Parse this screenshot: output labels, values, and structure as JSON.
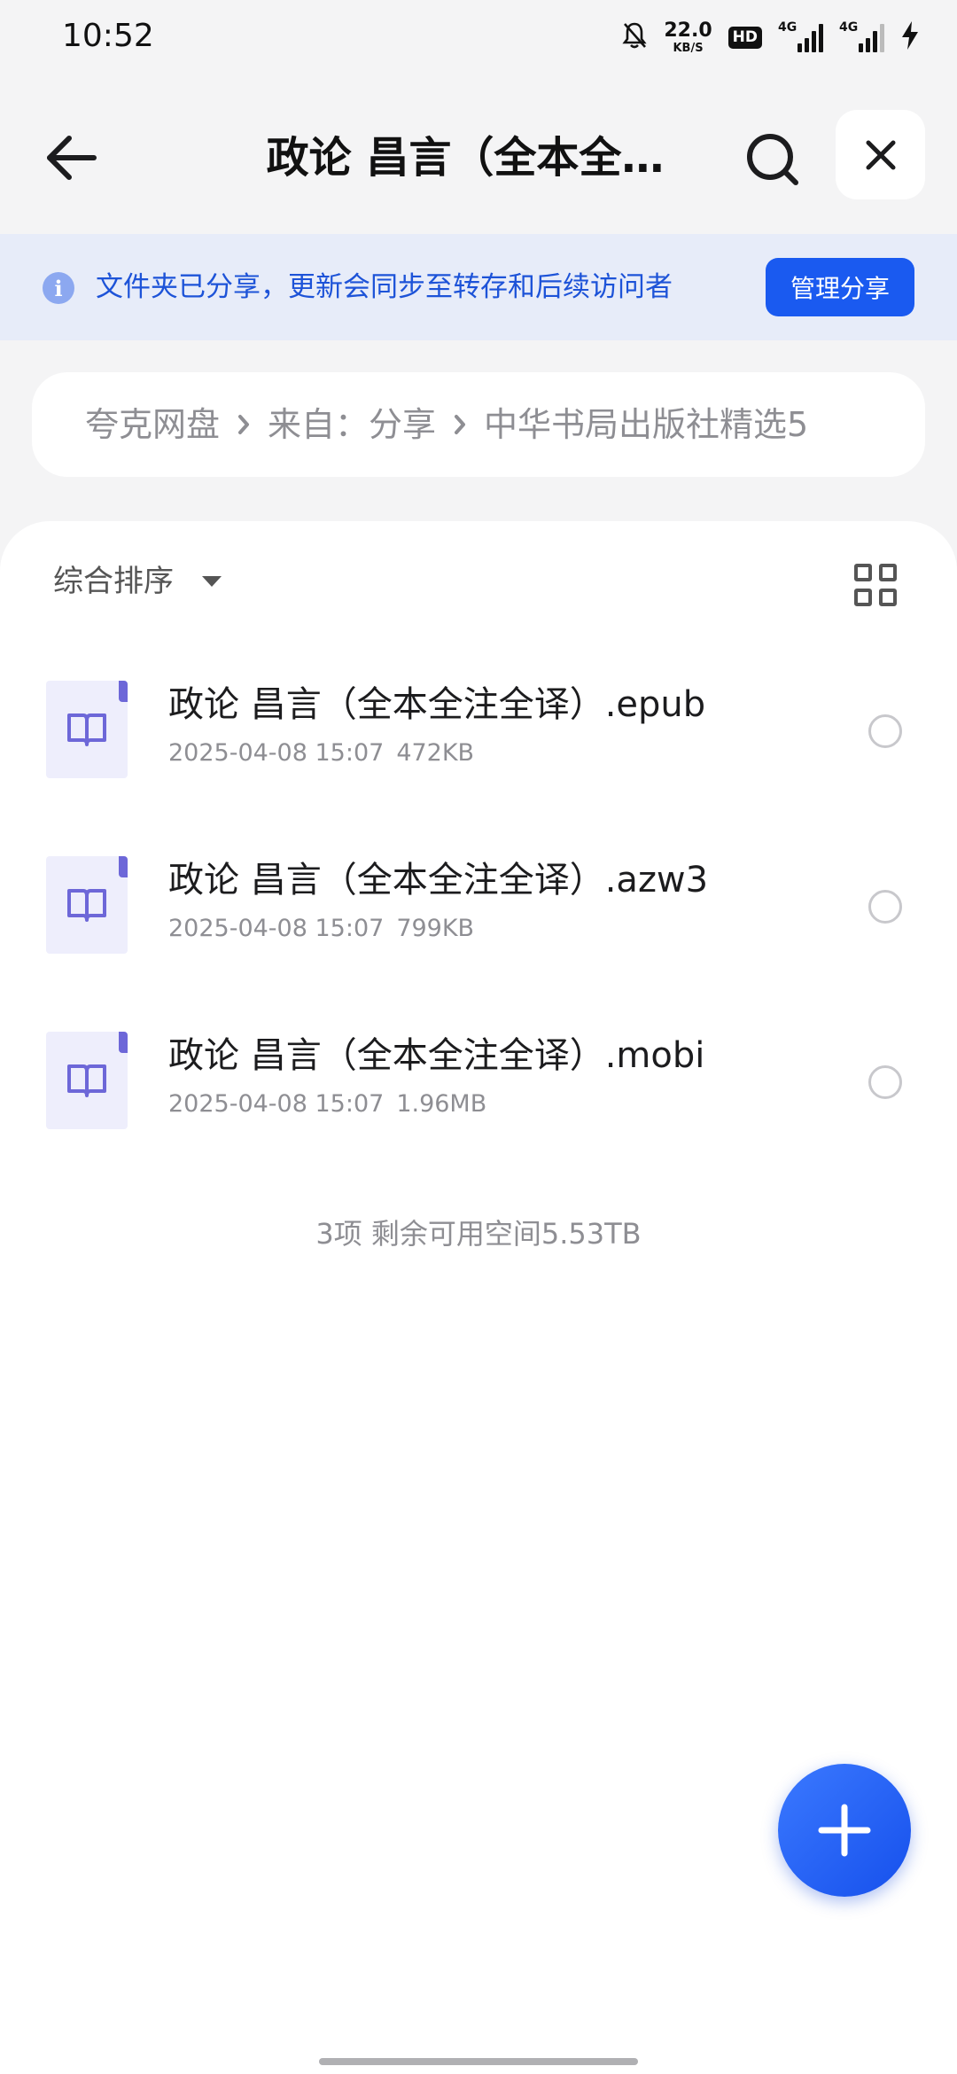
{
  "status_bar": {
    "time": "10:52",
    "net_speed_value": "22.0",
    "net_speed_unit": "KB/S",
    "hd_label": "HD",
    "sim1_label": "4G",
    "sim2_label": "4G",
    "icons": [
      "bell-off-icon",
      "hd-icon",
      "signal-icon",
      "signal-icon",
      "charging-icon"
    ]
  },
  "header": {
    "title": "政论 昌言（全本全…",
    "back_icon": "arrow-left-icon",
    "search_icon": "search-icon",
    "close_icon": "close-icon"
  },
  "share_banner": {
    "icon": "info-icon",
    "text": "文件夹已分享，更新会同步至转存和后续访问者",
    "manage_label": "管理分享"
  },
  "breadcrumb": [
    "夸克网盘",
    "来自：分享",
    "中华书局出版社精选5"
  ],
  "list": {
    "sort_label": "综合排序",
    "view_toggle_icon": "grid-view-icon",
    "files": [
      {
        "name": "政论 昌言（全本全注全译）.epub",
        "date": "2025-04-08 15:07",
        "size": "472KB",
        "icon": "ebook-icon"
      },
      {
        "name": "政论 昌言（全本全注全译）.azw3",
        "date": "2025-04-08 15:07",
        "size": "799KB",
        "icon": "ebook-icon"
      },
      {
        "name": "政论 昌言（全本全注全译）.mobi",
        "date": "2025-04-08 15:07",
        "size": "1.96MB",
        "icon": "ebook-icon"
      }
    ],
    "summary": "3项 剩余可用空间5.53TB"
  },
  "fab": {
    "icon": "plus-icon"
  },
  "colors": {
    "accent": "#1a5af0",
    "banner_bg": "#e7ecf9",
    "banner_text": "#1d53d8",
    "file_icon": "#6d67d8"
  }
}
